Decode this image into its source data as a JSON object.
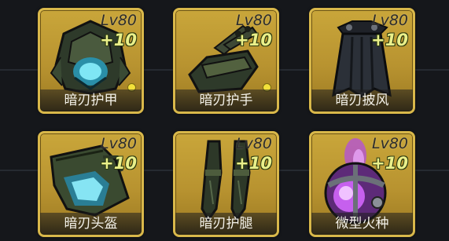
{
  "items": [
    {
      "level": "Lv80",
      "bonus": "+10",
      "name": "暗刃护甲",
      "icon": "dark-blade-armor-icon",
      "marked": true
    },
    {
      "level": "Lv80",
      "bonus": "+10",
      "name": "暗刃护手",
      "icon": "dark-blade-gauntlet-icon",
      "marked": true
    },
    {
      "level": "Lv80",
      "bonus": "+10",
      "name": "暗刃披风",
      "icon": "dark-blade-cloak-icon",
      "marked": false
    },
    {
      "level": "Lv80",
      "bonus": "+10",
      "name": "暗刃头盔",
      "icon": "dark-blade-helmet-icon",
      "marked": false
    },
    {
      "level": "Lv80",
      "bonus": "+10",
      "name": "暗刃护腿",
      "icon": "dark-blade-leggings-icon",
      "marked": false
    },
    {
      "level": "Lv80",
      "bonus": "+10",
      "name": "微型火种",
      "icon": "micro-ember-orb-icon",
      "marked": false
    }
  ],
  "colors": {
    "card_border": "#d9b84a",
    "card_fill": "#b89330",
    "bonus_text": "#eaf08a",
    "marker_dot": "#f3e13a"
  }
}
